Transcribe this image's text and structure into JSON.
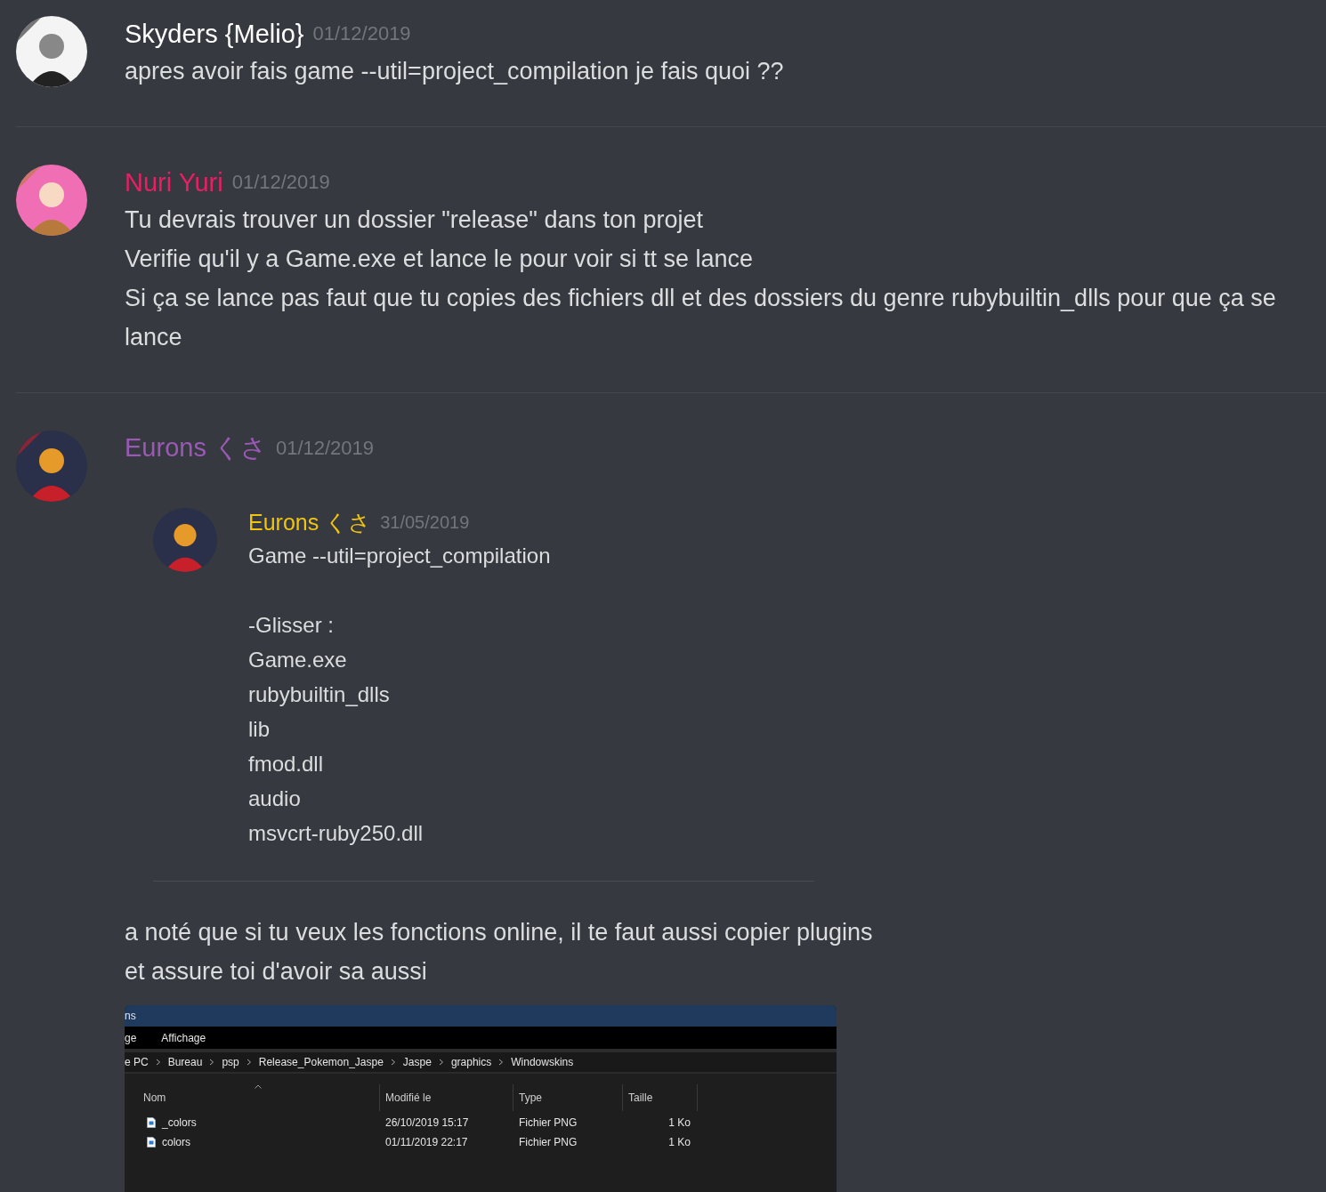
{
  "messages": [
    {
      "author": "Skyders {Melio}",
      "color": "#ffffff",
      "date": "01/12/2019",
      "lines": [
        "apres avoir fais game --util=project_compilation je fais quoi ??"
      ]
    },
    {
      "author": "Nuri Yuri",
      "color": "#e91e63",
      "date": "01/12/2019",
      "lines": [
        "Tu devrais trouver un dossier \"release\" dans ton projet",
        "Verifie qu'il y a Game.exe et lance le pour voir si tt se lance",
        "Si ça se lance pas faut que tu copies des fichiers dll et des dossiers du genre rubybuiltin_dlls pour que ça se lance"
      ]
    },
    {
      "author": "Eurons くさ",
      "color": "#9b59b6",
      "date": "01/12/2019",
      "quote": {
        "author": "Eurons くさ",
        "color": "#f1c40f",
        "date": "31/05/2019",
        "paragraphs": [
          [
            "Game --util=project_compilation"
          ],
          [
            "-Glisser :",
            "Game.exe",
            "rubybuiltin_dlls",
            "lib",
            "fmod.dll",
            "audio",
            "msvcrt-ruby250.dll"
          ]
        ]
      },
      "lines": [
        "a noté que si tu veux les fonctions online, il te faut aussi copier plugins",
        "et assure toi d'avoir sa aussi"
      ],
      "attachment": {
        "title": "ns",
        "menu": [
          "ge",
          "Affichage"
        ],
        "breadcrumb": [
          "e PC",
          "Bureau",
          "psp",
          "Release_Pokemon_Jaspe",
          "Jaspe",
          "graphics",
          "Windowskins"
        ],
        "columns": [
          "Nom",
          "Modifié le",
          "Type",
          "Taille"
        ],
        "rows": [
          {
            "name": "_colors",
            "modified": "26/10/2019 15:17",
            "type": "Fichier PNG",
            "size": "1 Ko"
          },
          {
            "name": "colors",
            "modified": "01/11/2019 22:17",
            "type": "Fichier PNG",
            "size": "1 Ko"
          }
        ]
      }
    }
  ]
}
